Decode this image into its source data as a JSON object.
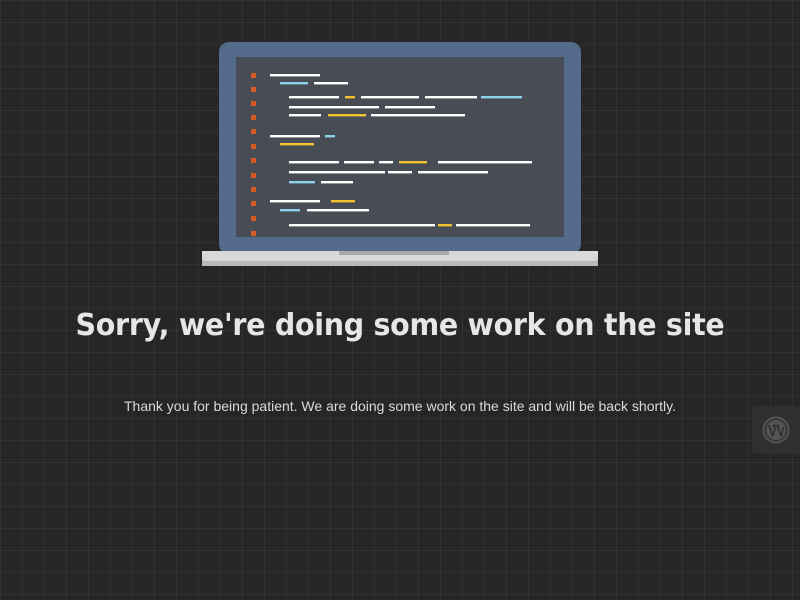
{
  "page": {
    "headline": "Sorry, we're doing some work on the site",
    "message": "Thank you for being patient. We are doing some work on the site and will be back shortly."
  },
  "illustration": {
    "icon": "laptop-code-icon",
    "colors": {
      "lid": "#556b8b",
      "screen": "#474c55",
      "base": "#d8d8d8",
      "base_shadow": "#a9a9a9",
      "gutter": "#d35c2a",
      "code_white": "#ffffff",
      "code_blue": "#8fd3e8",
      "code_yellow": "#f2c232"
    }
  },
  "badge": {
    "icon": "wordpress-logo-icon",
    "color": "#555555"
  },
  "colors": {
    "background": "#262626",
    "headline": "#e6e6e6",
    "text": "#d9d9d9"
  }
}
